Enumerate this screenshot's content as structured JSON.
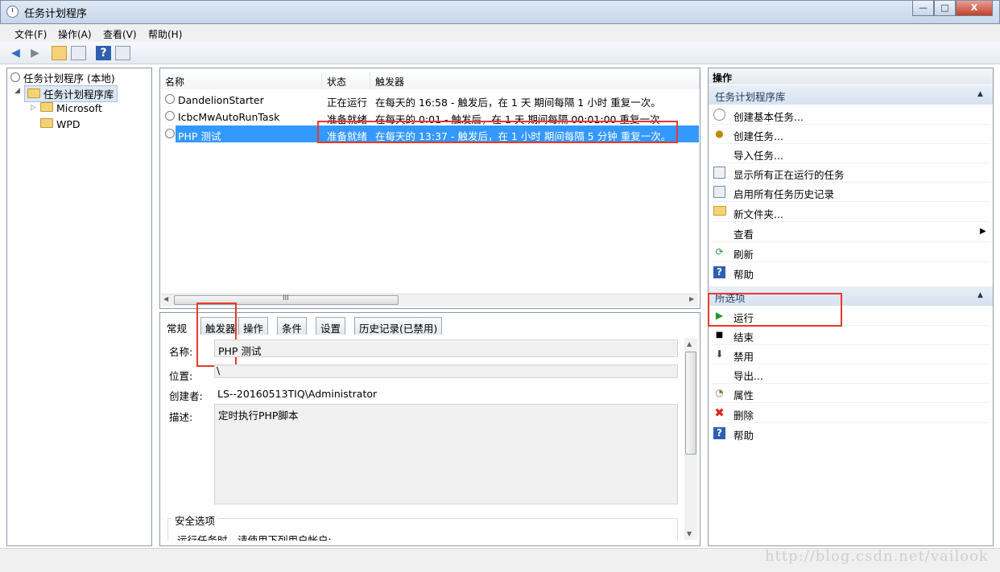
{
  "window": {
    "title": "任务计划程序",
    "min": "—",
    "max": "□",
    "close": "X"
  },
  "menu": [
    "文件(F)",
    "操作(A)",
    "查看(V)",
    "帮助(H)"
  ],
  "tree": {
    "root": "任务计划程序 (本地)",
    "library": "任务计划程序库",
    "children": [
      "Microsoft",
      "WPD"
    ]
  },
  "tasks": {
    "columns": [
      "名称",
      "状态",
      "触发器"
    ],
    "rows": [
      {
        "name": "DandelionStarter",
        "status": "正在运行",
        "trigger": "在每天的 16:58 - 触发后，在 1 天 期间每隔 1 小时 重复一次。"
      },
      {
        "name": "IcbcMwAutoRunTask",
        "status": "准备就绪",
        "trigger": "在每天的 0:01 - 触发后，在 1 天 期间每隔 00:01:00 重复一次"
      },
      {
        "name": "PHP 测试",
        "status": "准备就绪",
        "trigger": "在每天的 13:37 - 触发后，在 1 小时 期间每隔 5 分钟 重复一次。"
      }
    ],
    "scroll_mark": "III"
  },
  "tabs": [
    "常规",
    "触发器",
    "操作",
    "条件",
    "设置",
    "历史记录(已禁用)"
  ],
  "general": {
    "name_label": "名称:",
    "name": "PHP 测试",
    "location_label": "位置:",
    "location": "\\",
    "author_label": "创建者:",
    "author": "LS--20160513TIQ\\Administrator",
    "desc_label": "描述:",
    "desc": "定时执行PHP脚本",
    "security_label": "安全选项",
    "run_as": "运行任务时，请使用下列用户帐户:"
  },
  "actions": {
    "header": "操作",
    "section1": "任务计划程序库",
    "items1": [
      "创建基本任务...",
      "创建任务...",
      "导入任务...",
      "显示所有正在运行的任务",
      "启用所有任务历史记录",
      "新文件夹...",
      "查看",
      "刷新",
      "帮助"
    ],
    "section2": "所选项",
    "items2": [
      "运行",
      "结束",
      "禁用",
      "导出...",
      "属性",
      "删除",
      "帮助"
    ]
  },
  "watermark": "http://blog.csdn.net/vailook"
}
